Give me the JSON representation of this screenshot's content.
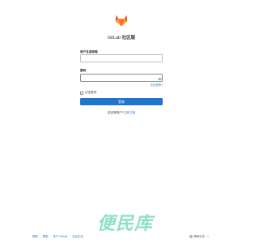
{
  "brand": {
    "name": "GitLab",
    "suffix": "社区版"
  },
  "login": {
    "username_label": "用户名或邮箱",
    "username_value": "",
    "password_label": "密码",
    "password_value": "",
    "forgot_label": "忘记密码?",
    "remember_label": "记住账号",
    "submit_label": "登录",
    "register_prompt": "还没有账户?",
    "register_link": "立即注册"
  },
  "footer": {
    "links": [
      "帮助",
      "帮助",
      "关于 GitLab",
      "社区论坛"
    ],
    "language_label": "简体中文"
  },
  "watermark": {
    "text": "便民库"
  },
  "colors": {
    "primary": "#1f75cb",
    "logo": "#e24329"
  }
}
